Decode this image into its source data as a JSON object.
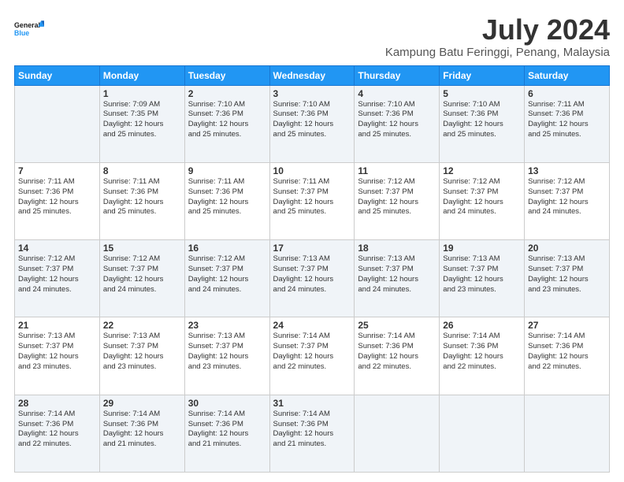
{
  "logo": {
    "text_general": "General",
    "text_blue": "Blue"
  },
  "header": {
    "month_year": "July 2024",
    "location": "Kampung Batu Feringgi, Penang, Malaysia"
  },
  "days_of_week": [
    "Sunday",
    "Monday",
    "Tuesday",
    "Wednesday",
    "Thursday",
    "Friday",
    "Saturday"
  ],
  "weeks": [
    [
      {
        "day": "",
        "sunrise": "",
        "sunset": "",
        "daylight": ""
      },
      {
        "day": "1",
        "sunrise": "Sunrise: 7:09 AM",
        "sunset": "Sunset: 7:35 PM",
        "daylight": "Daylight: 12 hours and 25 minutes."
      },
      {
        "day": "2",
        "sunrise": "Sunrise: 7:10 AM",
        "sunset": "Sunset: 7:36 PM",
        "daylight": "Daylight: 12 hours and 25 minutes."
      },
      {
        "day": "3",
        "sunrise": "Sunrise: 7:10 AM",
        "sunset": "Sunset: 7:36 PM",
        "daylight": "Daylight: 12 hours and 25 minutes."
      },
      {
        "day": "4",
        "sunrise": "Sunrise: 7:10 AM",
        "sunset": "Sunset: 7:36 PM",
        "daylight": "Daylight: 12 hours and 25 minutes."
      },
      {
        "day": "5",
        "sunrise": "Sunrise: 7:10 AM",
        "sunset": "Sunset: 7:36 PM",
        "daylight": "Daylight: 12 hours and 25 minutes."
      },
      {
        "day": "6",
        "sunrise": "Sunrise: 7:11 AM",
        "sunset": "Sunset: 7:36 PM",
        "daylight": "Daylight: 12 hours and 25 minutes."
      }
    ],
    [
      {
        "day": "7",
        "sunrise": "Sunrise: 7:11 AM",
        "sunset": "Sunset: 7:36 PM",
        "daylight": "Daylight: 12 hours and 25 minutes."
      },
      {
        "day": "8",
        "sunrise": "Sunrise: 7:11 AM",
        "sunset": "Sunset: 7:36 PM",
        "daylight": "Daylight: 12 hours and 25 minutes."
      },
      {
        "day": "9",
        "sunrise": "Sunrise: 7:11 AM",
        "sunset": "Sunset: 7:36 PM",
        "daylight": "Daylight: 12 hours and 25 minutes."
      },
      {
        "day": "10",
        "sunrise": "Sunrise: 7:11 AM",
        "sunset": "Sunset: 7:37 PM",
        "daylight": "Daylight: 12 hours and 25 minutes."
      },
      {
        "day": "11",
        "sunrise": "Sunrise: 7:12 AM",
        "sunset": "Sunset: 7:37 PM",
        "daylight": "Daylight: 12 hours and 25 minutes."
      },
      {
        "day": "12",
        "sunrise": "Sunrise: 7:12 AM",
        "sunset": "Sunset: 7:37 PM",
        "daylight": "Daylight: 12 hours and 24 minutes."
      },
      {
        "day": "13",
        "sunrise": "Sunrise: 7:12 AM",
        "sunset": "Sunset: 7:37 PM",
        "daylight": "Daylight: 12 hours and 24 minutes."
      }
    ],
    [
      {
        "day": "14",
        "sunrise": "Sunrise: 7:12 AM",
        "sunset": "Sunset: 7:37 PM",
        "daylight": "Daylight: 12 hours and 24 minutes."
      },
      {
        "day": "15",
        "sunrise": "Sunrise: 7:12 AM",
        "sunset": "Sunset: 7:37 PM",
        "daylight": "Daylight: 12 hours and 24 minutes."
      },
      {
        "day": "16",
        "sunrise": "Sunrise: 7:12 AM",
        "sunset": "Sunset: 7:37 PM",
        "daylight": "Daylight: 12 hours and 24 minutes."
      },
      {
        "day": "17",
        "sunrise": "Sunrise: 7:13 AM",
        "sunset": "Sunset: 7:37 PM",
        "daylight": "Daylight: 12 hours and 24 minutes."
      },
      {
        "day": "18",
        "sunrise": "Sunrise: 7:13 AM",
        "sunset": "Sunset: 7:37 PM",
        "daylight": "Daylight: 12 hours and 24 minutes."
      },
      {
        "day": "19",
        "sunrise": "Sunrise: 7:13 AM",
        "sunset": "Sunset: 7:37 PM",
        "daylight": "Daylight: 12 hours and 23 minutes."
      },
      {
        "day": "20",
        "sunrise": "Sunrise: 7:13 AM",
        "sunset": "Sunset: 7:37 PM",
        "daylight": "Daylight: 12 hours and 23 minutes."
      }
    ],
    [
      {
        "day": "21",
        "sunrise": "Sunrise: 7:13 AM",
        "sunset": "Sunset: 7:37 PM",
        "daylight": "Daylight: 12 hours and 23 minutes."
      },
      {
        "day": "22",
        "sunrise": "Sunrise: 7:13 AM",
        "sunset": "Sunset: 7:37 PM",
        "daylight": "Daylight: 12 hours and 23 minutes."
      },
      {
        "day": "23",
        "sunrise": "Sunrise: 7:13 AM",
        "sunset": "Sunset: 7:37 PM",
        "daylight": "Daylight: 12 hours and 23 minutes."
      },
      {
        "day": "24",
        "sunrise": "Sunrise: 7:14 AM",
        "sunset": "Sunset: 7:37 PM",
        "daylight": "Daylight: 12 hours and 22 minutes."
      },
      {
        "day": "25",
        "sunrise": "Sunrise: 7:14 AM",
        "sunset": "Sunset: 7:36 PM",
        "daylight": "Daylight: 12 hours and 22 minutes."
      },
      {
        "day": "26",
        "sunrise": "Sunrise: 7:14 AM",
        "sunset": "Sunset: 7:36 PM",
        "daylight": "Daylight: 12 hours and 22 minutes."
      },
      {
        "day": "27",
        "sunrise": "Sunrise: 7:14 AM",
        "sunset": "Sunset: 7:36 PM",
        "daylight": "Daylight: 12 hours and 22 minutes."
      }
    ],
    [
      {
        "day": "28",
        "sunrise": "Sunrise: 7:14 AM",
        "sunset": "Sunset: 7:36 PM",
        "daylight": "Daylight: 12 hours and 22 minutes."
      },
      {
        "day": "29",
        "sunrise": "Sunrise: 7:14 AM",
        "sunset": "Sunset: 7:36 PM",
        "daylight": "Daylight: 12 hours and 21 minutes."
      },
      {
        "day": "30",
        "sunrise": "Sunrise: 7:14 AM",
        "sunset": "Sunset: 7:36 PM",
        "daylight": "Daylight: 12 hours and 21 minutes."
      },
      {
        "day": "31",
        "sunrise": "Sunrise: 7:14 AM",
        "sunset": "Sunset: 7:36 PM",
        "daylight": "Daylight: 12 hours and 21 minutes."
      },
      {
        "day": "",
        "sunrise": "",
        "sunset": "",
        "daylight": ""
      },
      {
        "day": "",
        "sunrise": "",
        "sunset": "",
        "daylight": ""
      },
      {
        "day": "",
        "sunrise": "",
        "sunset": "",
        "daylight": ""
      }
    ]
  ]
}
